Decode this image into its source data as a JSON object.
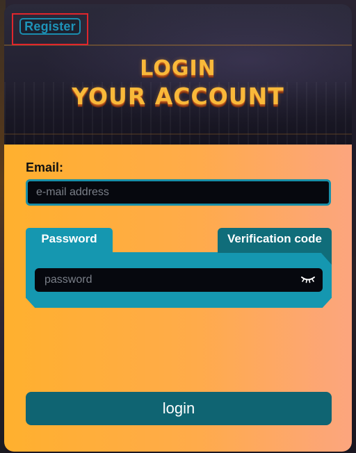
{
  "header": {
    "register_label": "Register",
    "title_line1": "LOGIN",
    "title_line2": "YOUR ACCOUNT"
  },
  "form": {
    "email_label": "Email:",
    "email_placeholder": "e-mail address",
    "email_value": "",
    "tabs": [
      {
        "label": "Password",
        "active": true
      },
      {
        "label": "Verification code",
        "active": false
      }
    ],
    "password_placeholder": "password",
    "password_value": "",
    "password_visibility_icon": "eye-closed-icon",
    "login_label": "login"
  },
  "colors": {
    "accent_teal": "#1597b0",
    "dark_teal": "#106d7a",
    "login_button": "#0f6472",
    "form_gradient_start": "#ffb02e",
    "form_gradient_end": "#fca57e",
    "highlight_box": "#e0262c"
  }
}
